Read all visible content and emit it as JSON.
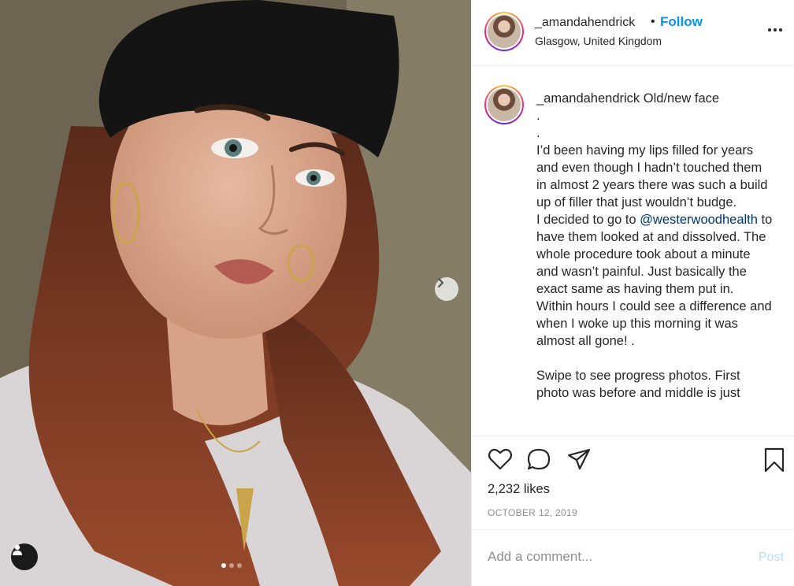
{
  "post": {
    "username": "_amandahendrick",
    "separator": "•",
    "follow_label": "Follow",
    "location": "Glasgow, United Kingdom",
    "caption_title": "Old/new face",
    "caption_body": ".\n.\nI’d been having my lips filled for years and even though I hadn’t touched them in almost 2 years there was such a build up of filler that just wouldn’t budge.\nI decided to go to ",
    "caption_mention": "@westerwoodhealth",
    "caption_tail": " to have them looked at and dissolved. The whole procedure took about a minute and wasn’t painful. Just basically the exact same as having them put in. Within hours I could see a difference and when I woke up this morning it was almost all gone! .\n\nSwipe to see progress photos. First photo was before and middle is just",
    "likes": "2,232 likes",
    "date": "OCTOBER 12, 2019"
  },
  "carousel": {
    "slide_count": 3,
    "active_slide": 1
  },
  "comment": {
    "placeholder": "Add a comment...",
    "post_label": "Post"
  },
  "colors": {
    "link_blue": "#0095f6",
    "mention_blue": "#00376b",
    "post_disabled": "#b2dffc",
    "muted": "#8e8e8e"
  },
  "icons": {
    "more": "more-options-icon",
    "like": "heart-icon",
    "comment": "comment-bubble-icon",
    "share": "paper-plane-icon",
    "save": "bookmark-icon",
    "next": "chevron-right-icon",
    "tag": "user-tag-icon"
  }
}
